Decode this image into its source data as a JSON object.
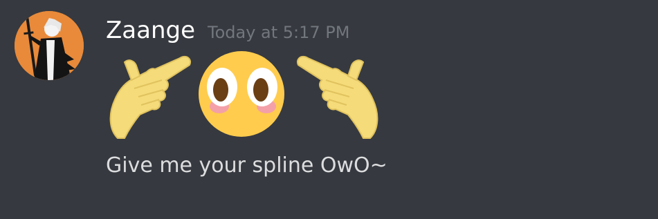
{
  "message": {
    "author": "Zaange",
    "timestamp": "Today at 5:17 PM",
    "content": "Give me your spline OwO~",
    "avatar_icon": "anime-character-avatar",
    "emotes": [
      "pointing-hand-left-emote",
      "flushed-face-emote",
      "pointing-hand-right-emote"
    ]
  },
  "colors": {
    "background": "#36393f",
    "username": "#ffffff",
    "timestamp": "#72767d",
    "text": "#dcddde",
    "avatar_bg": "#e88a3a"
  }
}
